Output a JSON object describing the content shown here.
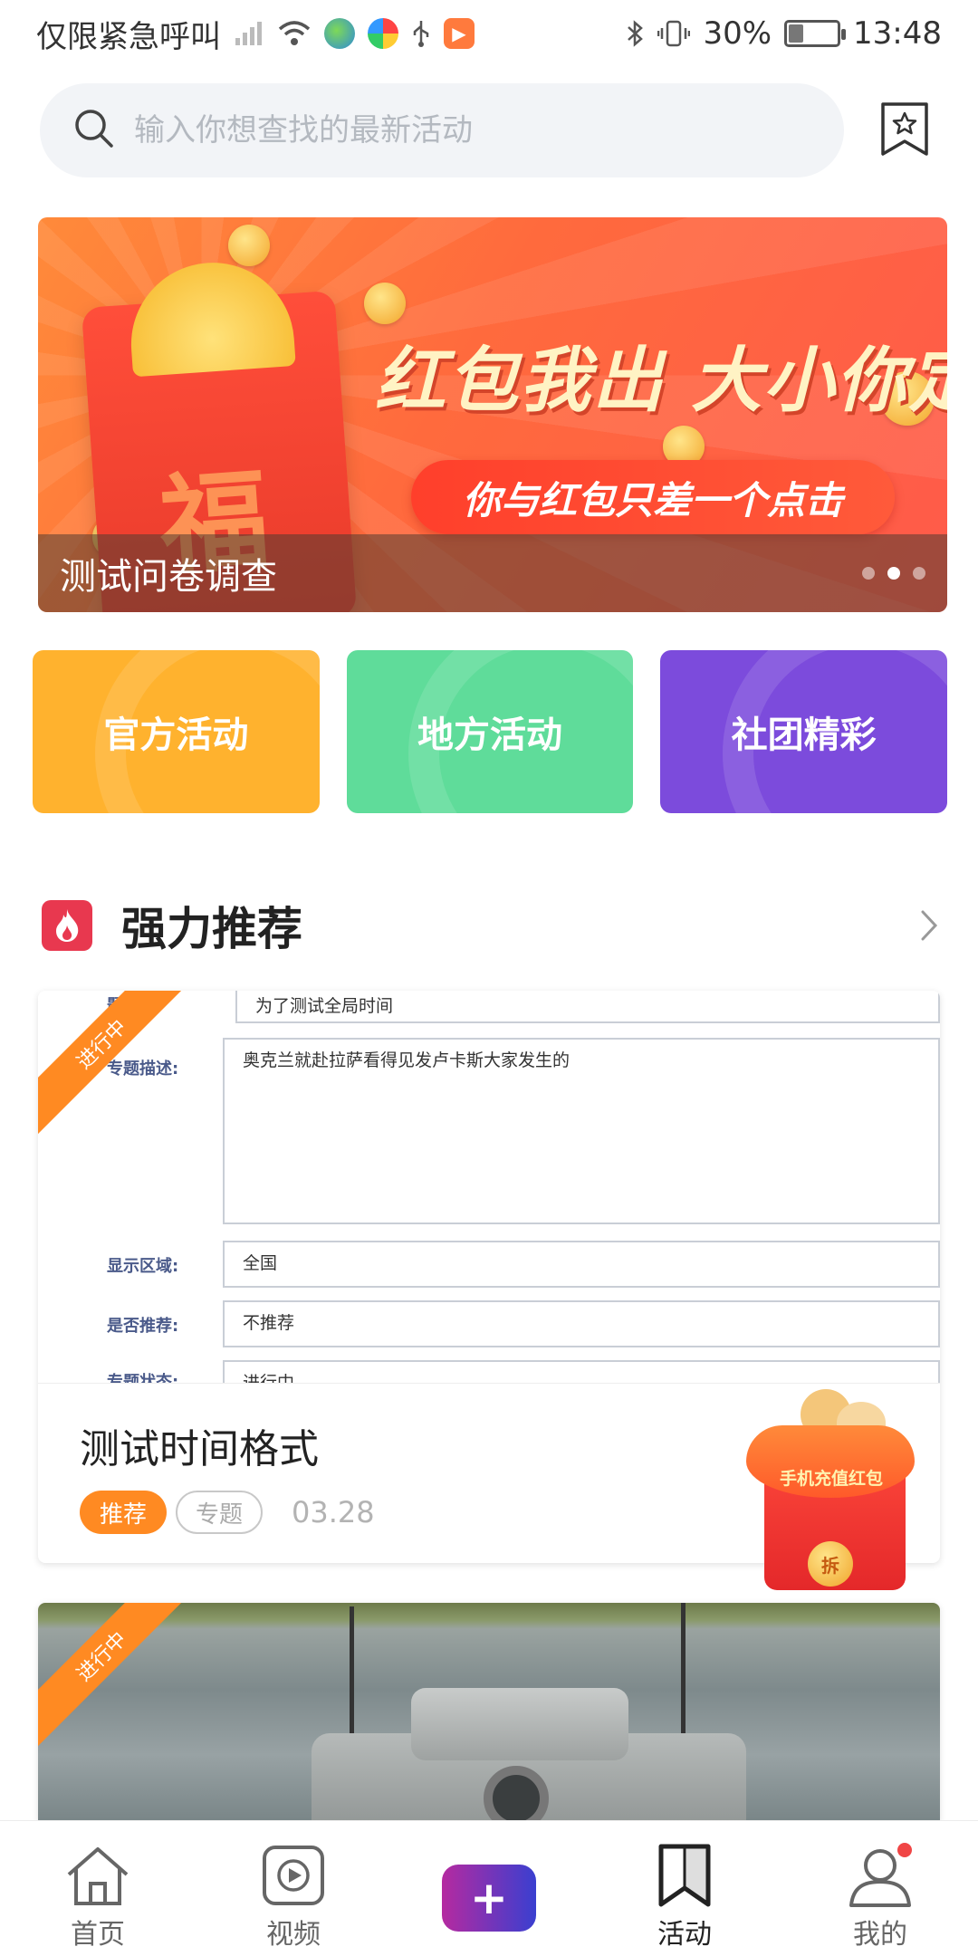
{
  "status_bar": {
    "carrier": "仅限紧急呼叫",
    "battery": "30%",
    "battery_level": 0.3,
    "time": "13:48",
    "media_badge": "▶"
  },
  "search": {
    "placeholder": "输入你想查找的最新活动"
  },
  "banner": {
    "headline": "红包我出 大小你定",
    "subline": "你与红包只差一个点击",
    "envelope_char": "福",
    "caption": "测试问卷调查",
    "dot_count": 3,
    "active_dot": 1
  },
  "categories": [
    {
      "label": "官方活动",
      "color": "#ffb22e"
    },
    {
      "label": "地方活动",
      "color": "#5fdc9a"
    },
    {
      "label": "社团精彩",
      "color": "#7c4bdc"
    }
  ],
  "section": {
    "title": "强力推荐"
  },
  "card1": {
    "ribbon": "进行中",
    "form": {
      "rows": [
        {
          "label": "题标题:",
          "value": "为了测试全局时间"
        },
        {
          "label": "专题描述:",
          "value": "奥克兰就赴拉萨看得见发卢卡斯大家发生的"
        },
        {
          "label": "显示区域:",
          "value": "全国"
        },
        {
          "label": "是否推荐:",
          "value": "不推荐"
        },
        {
          "label": "专题状态:",
          "value": "进行中"
        }
      ]
    },
    "title": "测试时间格式",
    "tag_recommend": "推荐",
    "tag_topic": "专题",
    "date": "03.28"
  },
  "red_packet": {
    "text": "手机充值红包",
    "coin": "拆"
  },
  "card2": {
    "ribbon": "进行中"
  },
  "bottom_nav": {
    "items": [
      {
        "label": "首页",
        "icon": "home-icon"
      },
      {
        "label": "视频",
        "icon": "video-icon"
      },
      {
        "label": "",
        "icon": "plus-icon"
      },
      {
        "label": "活动",
        "icon": "bookmark-icon"
      },
      {
        "label": "我的",
        "icon": "profile-icon"
      }
    ],
    "plus_glyph": "+"
  }
}
